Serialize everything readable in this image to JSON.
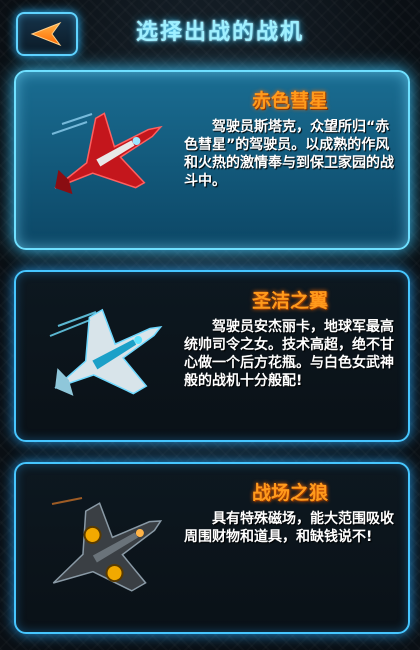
{
  "header": {
    "title": "选择出战的战机",
    "back_icon": "back-arrow-icon"
  },
  "colors": {
    "accent": "#46c6ff",
    "name": "#ff9a1c",
    "selected_bg": "#1a6d92"
  },
  "fighters": [
    {
      "name": "赤色彗星",
      "description": "驾驶员斯塔克，众望所归“赤色彗星”的驾驶员。以成熟的作风和火热的激情奉与到保卫家园的战斗中。",
      "selected": true,
      "icon": "red-jet-icon"
    },
    {
      "name": "圣洁之翼",
      "description": "驾驶员安杰丽卡，地球军最高统帅司令之女。技术高超，绝不甘心做一个后方花瓶。与白色女武神般的战机十分般配!",
      "selected": false,
      "icon": "white-jet-icon"
    },
    {
      "name": "战场之狼",
      "description": "具有特殊磁场，能大范围吸收周围财物和道具，和缺钱说不!",
      "selected": false,
      "icon": "dark-jet-icon"
    }
  ]
}
